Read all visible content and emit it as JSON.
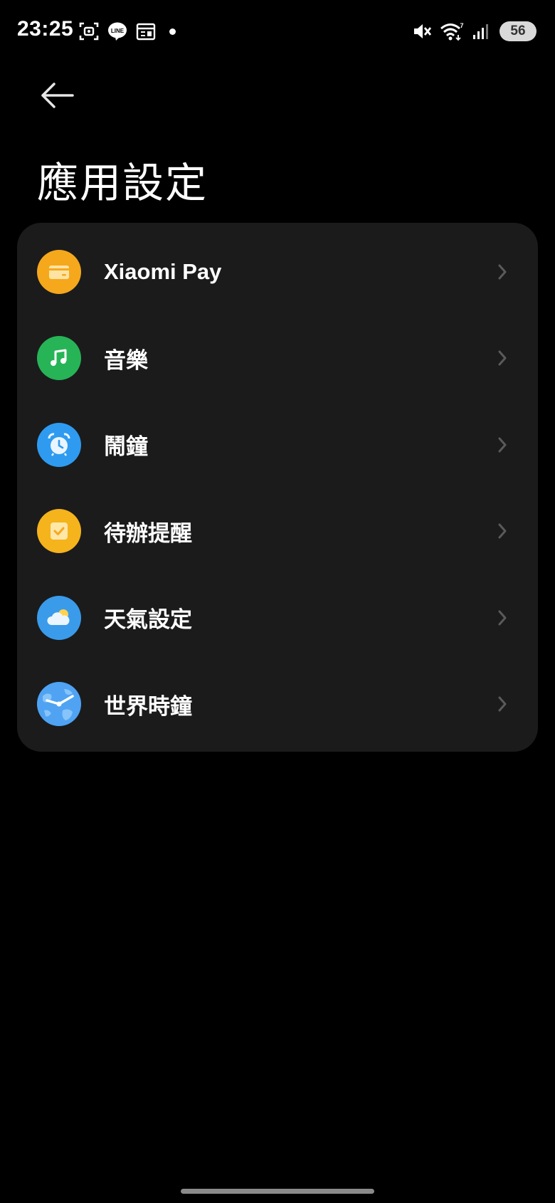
{
  "status_bar": {
    "time": "23:25",
    "left_icons": [
      "screenshot-icon",
      "line-app-icon",
      "calendar-news-icon",
      "notification-dot-icon"
    ],
    "right_icons": [
      "mute-icon",
      "wifi-icon",
      "signal-icon"
    ],
    "battery": "56"
  },
  "header": {
    "back_icon": "back-arrow-icon",
    "title": "應用設定"
  },
  "settings": {
    "items": [
      {
        "label": "Xiaomi Pay",
        "icon": "wallet-card-icon",
        "color": "#F5A81C"
      },
      {
        "label": "音樂",
        "icon": "music-note-icon",
        "color": "#27B457"
      },
      {
        "label": "鬧鐘",
        "icon": "alarm-clock-icon",
        "color": "#2E9BF0"
      },
      {
        "label": "待辦提醒",
        "icon": "todo-check-icon",
        "color": "#F5B31C"
      },
      {
        "label": "天氣設定",
        "icon": "weather-cloud-icon",
        "color": "#3A9BEA"
      },
      {
        "label": "世界時鐘",
        "icon": "world-clock-icon",
        "color": "#3D8FE8"
      }
    ]
  },
  "colors": {
    "background": "#000000",
    "card": "#1B1B1C",
    "chevron": "#5A5A5C"
  }
}
